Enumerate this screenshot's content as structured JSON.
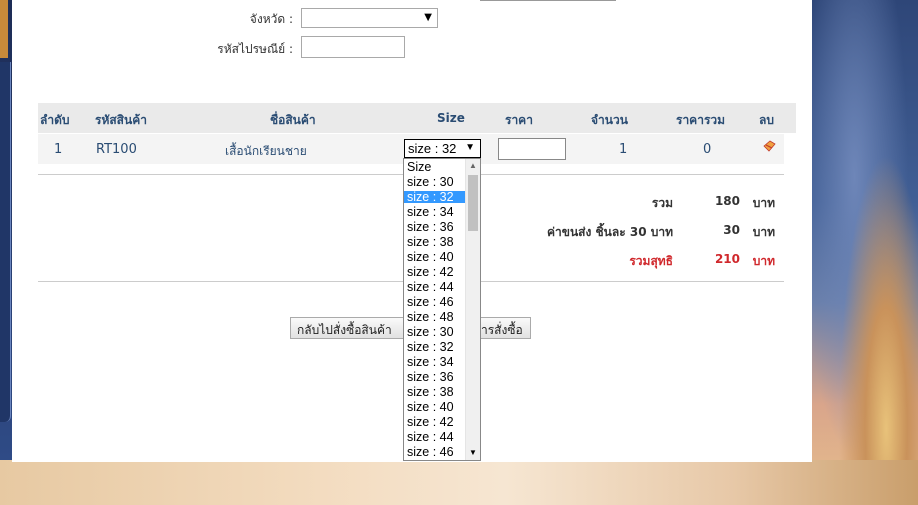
{
  "form": {
    "province_label": "จังหวัด :",
    "province_value": "",
    "postcode_label": "รหัสไปรษณีย์ :",
    "postcode_value": ""
  },
  "table": {
    "headers": [
      "ลำดับ",
      "รหัสสินค้า",
      "ชื่อสินค้า",
      "Size",
      "ราคา",
      "จำนวน",
      "ราคารวม",
      "ลบ"
    ],
    "rows": [
      {
        "index": "1",
        "code": "RT100",
        "name": "เสื้อนักเรียนชาย",
        "size": "size : 32",
        "price": "",
        "qty": "1",
        "total": "0"
      }
    ]
  },
  "summary": {
    "sum_label": "รวม",
    "sum_value": "180",
    "sum_unit": "บาท",
    "shipping_label": "ค่าขนส่ง ชิ้นละ 30 บาท",
    "shipping_value": "30",
    "shipping_unit": "บาท",
    "net_label": "รวมสุทธิ",
    "net_value": "210",
    "net_unit": "บาท"
  },
  "buttons": {
    "back_label": "กลับไปสั่งซื้อสินค้า",
    "confirm_label_visible": "ารสั่งซื้อ"
  },
  "size_dropdown": {
    "selected": "size : 32",
    "options": [
      "Size",
      "size : 30",
      "size : 32",
      "size : 34",
      "size : 36",
      "size : 38",
      "size : 40",
      "size : 42",
      "size : 44",
      "size : 46",
      "size : 48",
      "size : 30",
      "size : 32",
      "size : 34",
      "size : 36",
      "size : 38",
      "size : 40",
      "size : 42",
      "size : 44",
      "size : 46"
    ],
    "highlighted_index": 2
  },
  "icons": {
    "delete": "delete-icon",
    "dropdown_arrow": "chevron-down-icon"
  },
  "colors": {
    "header_text": "#2a4c73",
    "net_total": "#d0282c",
    "selection": "#3399ff"
  }
}
